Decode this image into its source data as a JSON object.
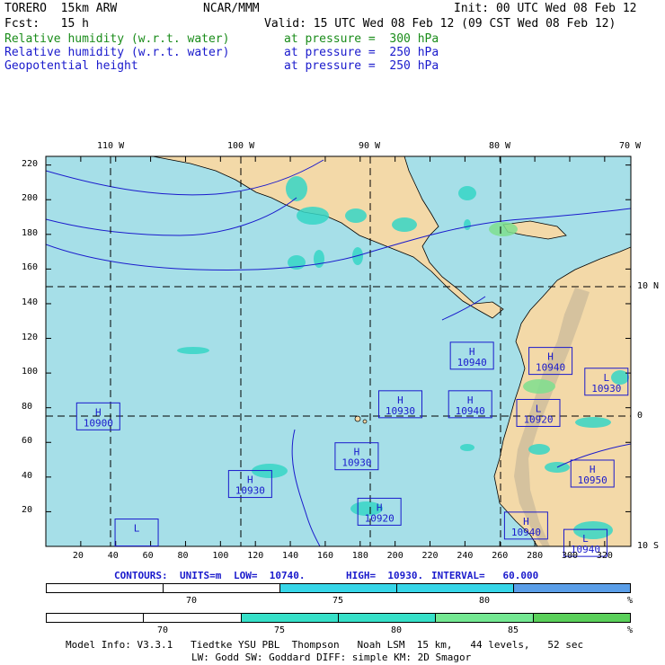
{
  "header": {
    "model": "TORERO  15km ARW",
    "org": "NCAR/MMM",
    "init": "Init: 00 UTC Wed 08 Feb 12",
    "fcst": "Fcst:   15 h",
    "valid": "Valid: 15 UTC Wed 08 Feb 12 (09 CST Wed 08 Feb 12)",
    "fields": [
      {
        "name": "Relative humidity (w.r.t. water)",
        "level": "at pressure =  300 hPa",
        "color": "#1a8c1a"
      },
      {
        "name": "Relative humidity (w.r.t. water)",
        "level": "at pressure =  250 hPa",
        "color": "#1a1acc"
      },
      {
        "name": "Geopotential height",
        "level": "at pressure =  250 hPa",
        "color": "#1a1acc"
      }
    ]
  },
  "map": {
    "lon_labels": [
      "110 W",
      "100 W",
      "90 W",
      "80 W",
      "70 W"
    ],
    "lat_labels": [
      "10 N",
      "0",
      "10 S"
    ],
    "x_ticks": [
      "20",
      "40",
      "60",
      "80",
      "100",
      "120",
      "140",
      "160",
      "180",
      "200",
      "220",
      "240",
      "260",
      "280",
      "300",
      "320"
    ],
    "y_ticks": [
      "220",
      "200",
      "180",
      "160",
      "140",
      "120",
      "100",
      "80",
      "60",
      "40",
      "20"
    ],
    "grid_x_range": [
      0,
      335
    ],
    "grid_y_range": [
      0,
      225
    ],
    "colors": {
      "ocean": "#a6dfe8",
      "land": "#f3d9a8",
      "rh_low": "#36d6c6",
      "rh_mid": "#7fe08f",
      "contour": "#1a1acc"
    },
    "highs_lows": [
      {
        "letter": "H",
        "value": "10900",
        "x": 30,
        "y": 75
      },
      {
        "letter": "L",
        "value": "",
        "x": 52,
        "y": 8
      },
      {
        "letter": "H",
        "value": "10930",
        "x": 117,
        "y": 36
      },
      {
        "letter": "H",
        "value": "10930",
        "x": 178,
        "y": 52
      },
      {
        "letter": "H",
        "value": "10920",
        "x": 191,
        "y": 20
      },
      {
        "letter": "H",
        "value": "10930",
        "x": 203,
        "y": 82
      },
      {
        "letter": "H",
        "value": "10940",
        "x": 244,
        "y": 110
      },
      {
        "letter": "H",
        "value": "10940",
        "x": 243,
        "y": 82
      },
      {
        "letter": "H",
        "value": "10940",
        "x": 289,
        "y": 107
      },
      {
        "letter": "L",
        "value": "10920",
        "x": 282,
        "y": 77
      },
      {
        "letter": "L",
        "value": "10930",
        "x": 321,
        "y": 95
      },
      {
        "letter": "H",
        "value": "10950",
        "x": 313,
        "y": 42
      },
      {
        "letter": "H",
        "value": "10940",
        "x": 275,
        "y": 12
      },
      {
        "letter": "L",
        "value": "10940",
        "x": 309,
        "y": 2
      }
    ]
  },
  "contours_line": {
    "contours": "CONTOURS:",
    "units": "UNITS=m",
    "low": "LOW=  10740.",
    "high": "HIGH=  10930.",
    "interval": "INTERVAL=   60.000"
  },
  "colorbar1": {
    "labels": [
      "70",
      "75",
      "80"
    ],
    "unit": "%",
    "colors": [
      "#ffffff",
      "#ffffff",
      "#36d6e8",
      "#36d6e8",
      "#5a9ee8"
    ]
  },
  "colorbar2": {
    "labels": [
      "70",
      "75",
      "80",
      "85"
    ],
    "unit": "%",
    "colors": [
      "#ffffff",
      "#ffffff",
      "#36e0c8",
      "#36e0c8",
      "#74e892",
      "#5ad05a"
    ]
  },
  "footer": {
    "line1": "Model Info: V3.3.1   Tiedtke YSU PBL  Thompson   Noah LSM  15 km,   44 levels,   52 sec",
    "line2": "LW: Godd SW: Goddard DIFF: simple KM: 2D Smagor"
  }
}
